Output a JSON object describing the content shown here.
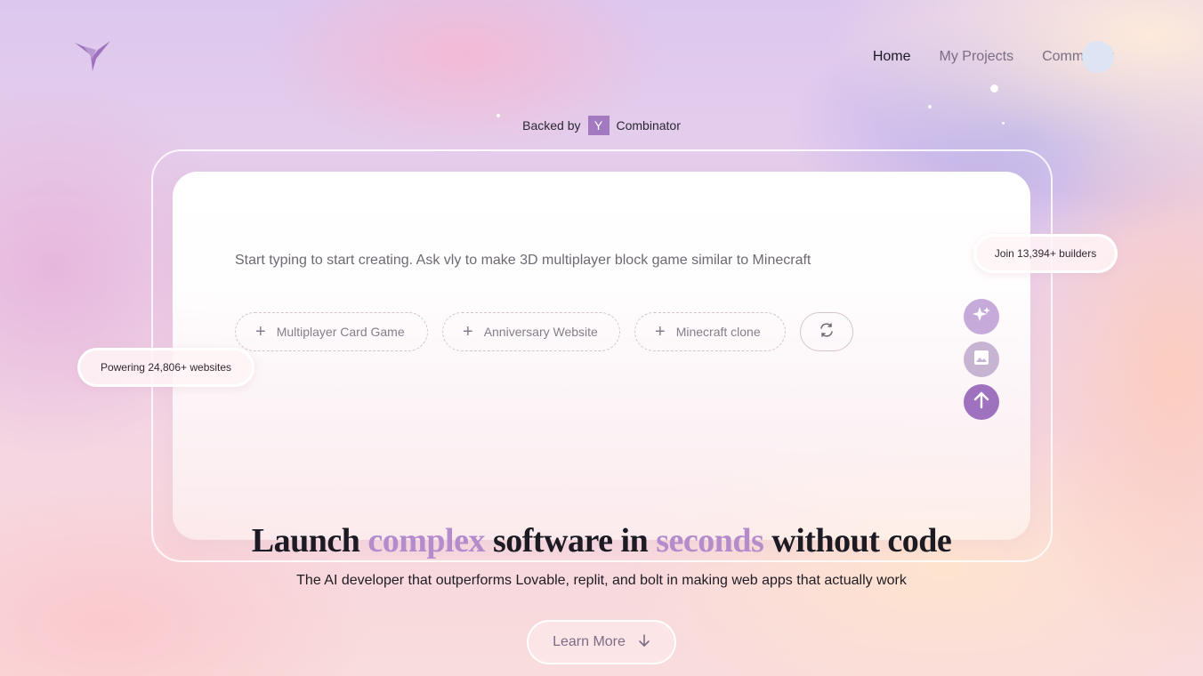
{
  "header": {
    "logo_icon": "bird-logo-icon",
    "nav": [
      {
        "label": "Home",
        "active": true
      },
      {
        "label": "My Projects",
        "active": false
      },
      {
        "label": "Community",
        "active": false
      }
    ]
  },
  "backed": {
    "prefix": "Backed by",
    "badge": "Y",
    "suffix": "Combinator",
    "badge_color": "#a37ac0"
  },
  "prompt": {
    "placeholder": "Start typing to start creating. Ask vly to make 3D multiplayer block game similar to Minecraft"
  },
  "suggestions": [
    {
      "label": "Multiplayer Card Game",
      "icon": "plus-icon"
    },
    {
      "label": "Anniversary Website",
      "icon": "plus-icon"
    },
    {
      "label": "Minecraft clone",
      "icon": "plus-icon"
    }
  ],
  "actions": {
    "refresh_icon": "refresh-icon",
    "enhance_icon": "sparkle-icon",
    "image_icon": "image-icon",
    "send_icon": "arrow-up-icon",
    "accent": "#9e72bf"
  },
  "stats": {
    "join": "Join 13,394+ builders",
    "powering": "Powering 24,806+ websites"
  },
  "hero": {
    "headline_parts": [
      "Launch ",
      "complex",
      " software in ",
      "seconds",
      " without code"
    ],
    "accent_color": "#b48ccc",
    "subhead": "The AI developer that outperforms Lovable, replit, and bolt in making web apps that actually work",
    "cta": "Learn More",
    "cta_icon": "arrow-down-icon"
  }
}
